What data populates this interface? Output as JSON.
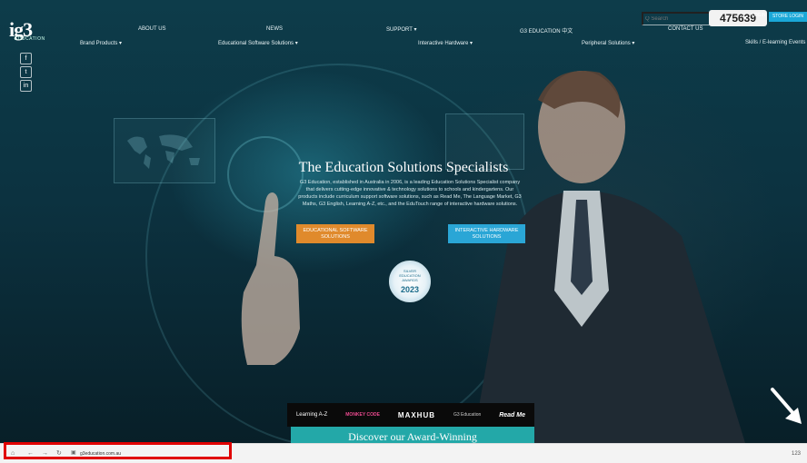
{
  "site": {
    "logo_text": "ig3",
    "logo_sub": "EDUCATION",
    "social": [
      "f",
      "t",
      "in"
    ]
  },
  "nav_top": [
    {
      "label": "ABOUT US"
    },
    {
      "label": "NEWS"
    },
    {
      "label": "SUPPORT ▾"
    },
    {
      "label": "G3 EDUCATION 中文"
    },
    {
      "label": "CONTACT US"
    }
  ],
  "nav_sub": [
    {
      "label": "Brand Products ▾"
    },
    {
      "label": "Educational Software Solutions ▾"
    },
    {
      "label": "Interactive Hardware ▾"
    },
    {
      "label": "Peripheral Solutions ▾"
    },
    {
      "label": "Skills / E-learning Events"
    }
  ],
  "search": {
    "placeholder": "Q Search"
  },
  "counter": {
    "value": "475639"
  },
  "login": {
    "label": "LOGIN"
  },
  "cta_top": {
    "label": "STORE LOGIN"
  },
  "hero": {
    "title": "The Education Solutions Specialists",
    "text": "G3 Education, established in Australia in 2006, is a leading Education Solutions Specialist company that delivers cutting-edge innovative & technology solutions to schools and kindergartens. Our products include curriculum support software solutions, such as Read Me, The Language Market, G3 Maths, G3 English, Learning A-Z, etc., and the EduTouch range of interactive hardware solutions.",
    "btn_software": "EDUCATIONAL SOFTWARE SOLUTIONS",
    "btn_hardware": "INTERACTIVE HARDWARE SOLUTIONS"
  },
  "badge": {
    "line1": "SILVER",
    "line2": "EDUCATION",
    "line3": "AWARDS",
    "year": "2023"
  },
  "brands": [
    {
      "name": "Learning A-Z"
    },
    {
      "name": "MONKEY CODE"
    },
    {
      "name": "MAXHUB"
    },
    {
      "name": "G3 Education"
    },
    {
      "name": "Read Me"
    }
  ],
  "discover": {
    "label": "Discover our Award-Winning"
  },
  "taskbar": {
    "url": "g3education.com.au",
    "right": "123"
  },
  "colors": {
    "accent_orange": "#e08a2c",
    "accent_blue": "#2aa6d6",
    "teal": "#23a8a8",
    "highlight_red": "#e00000"
  }
}
